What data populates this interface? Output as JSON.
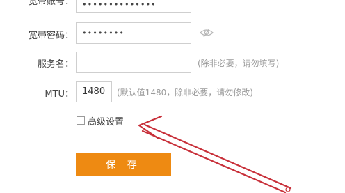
{
  "form": {
    "account": {
      "label": "宽带账号：",
      "value": "••••••••••••••"
    },
    "password": {
      "label": "宽带密码：",
      "value": "••••••••",
      "toggle_icon": "eye-slash-icon"
    },
    "service_name": {
      "label": "服务名：",
      "value": "",
      "hint": "(除非必要，请勿填写)"
    },
    "mtu": {
      "label": "MTU：",
      "value": "1480",
      "hint": "(默认值1480，除非必要，请勿修改)"
    },
    "advanced": {
      "label": "高级设置",
      "checked": false
    },
    "save_label": "保 存"
  },
  "annotation": {
    "color": "#c8303a"
  }
}
